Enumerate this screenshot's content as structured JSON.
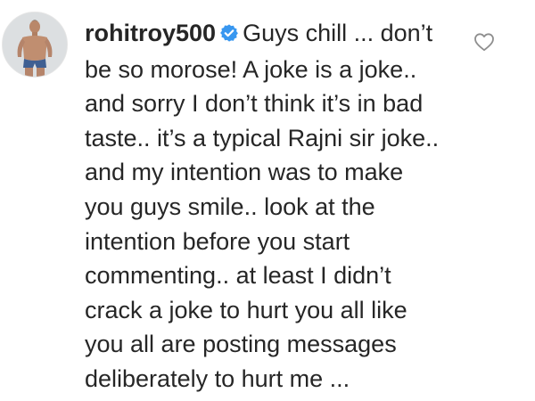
{
  "comment": {
    "username": "rohitroy500",
    "verified": true,
    "text_lines": [
      "Guys chill ... don’t",
      "be so morose! A joke is a joke..",
      "and sorry I don’t think it’s in bad",
      "taste.. it’s a typical Rajni sir joke..",
      "and my intention was to make",
      "you guys smile.. look at the",
      "intention before you start",
      "commenting.. at least I didn’t",
      "crack a joke to hurt you all like",
      "you all are posting messages",
      "deliberately to hurt me ..."
    ]
  },
  "icons": {
    "verified": "verified-badge-icon",
    "like": "heart-outline-icon"
  },
  "colors": {
    "text": "#262626",
    "verified_badge": "#3897f0",
    "heart_outline": "#8e8e8e"
  }
}
